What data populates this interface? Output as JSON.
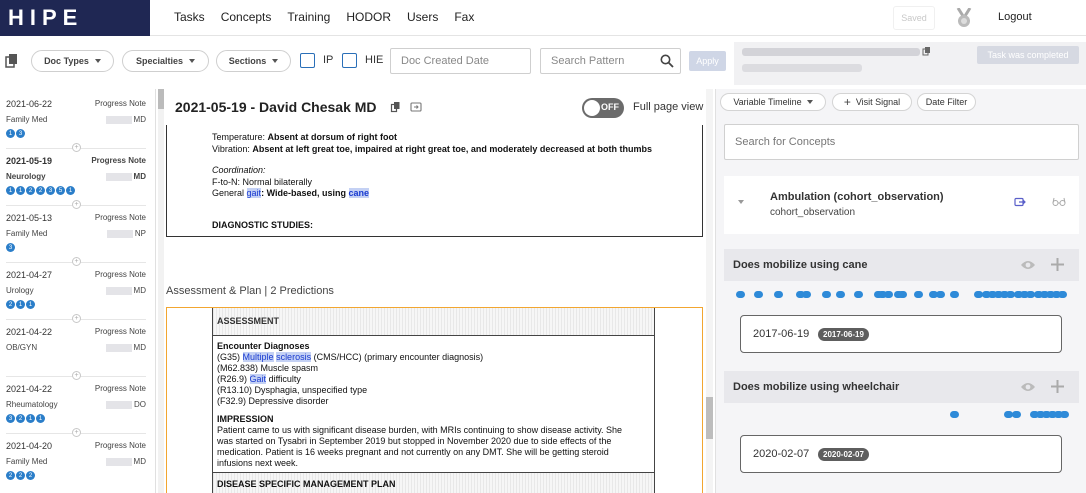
{
  "app": {
    "logo": "HIPE"
  },
  "nav": {
    "links": [
      "Tasks",
      "Concepts",
      "Training",
      "HODOR",
      "Users",
      "Fax"
    ],
    "saved": "Saved",
    "logout": "Logout"
  },
  "filters": {
    "doc_types": "Doc Types",
    "specialties": "Specialties",
    "sections": "Sections",
    "ip": "IP",
    "hie": "HIE",
    "doc_created_placeholder": "Doc Created Date",
    "search_placeholder": "Search Pattern",
    "apply": "Apply",
    "task_status": "Task was completed"
  },
  "doc_list": [
    {
      "date": "2021-06-22",
      "type": "Progress Note",
      "specialty": "Family Med",
      "cred": "MD",
      "badges": [
        "1",
        "3"
      ],
      "selected": false
    },
    {
      "date": "2021-05-19",
      "type": "Progress Note",
      "specialty": "Neurology",
      "cred": "MD",
      "badges": [
        "1",
        "1",
        "2",
        "2",
        "3",
        "5",
        "1"
      ],
      "selected": true
    },
    {
      "date": "2021-05-13",
      "type": "Progress Note",
      "specialty": "Family Med",
      "cred": "NP",
      "badges": [
        "3"
      ],
      "selected": false
    },
    {
      "date": "2021-04-27",
      "type": "Progress Note",
      "specialty": "Urology",
      "cred": "MD",
      "badges": [
        "2",
        "1",
        "1"
      ],
      "selected": false
    },
    {
      "date": "2021-04-22",
      "type": "Progress Note",
      "specialty": "OB/GYN",
      "cred": "MD",
      "badges": [],
      "selected": false
    },
    {
      "date": "2021-04-22",
      "type": "Progress Note",
      "specialty": "Rheumatology",
      "cred": "DO",
      "badges": [
        "3",
        "2",
        "1",
        "1"
      ],
      "selected": false
    },
    {
      "date": "2021-04-20",
      "type": "Progress Note",
      "specialty": "Family Med",
      "cred": "MD",
      "badges": [
        "2",
        "2",
        "2"
      ],
      "selected": false
    }
  ],
  "viewer": {
    "title": "2021-05-19 - David Chesak MD",
    "toggle": "OFF",
    "full_page": "Full page view",
    "exam": {
      "temp_label": "Temperature:",
      "temp_value": "Absent at dorsum of right foot",
      "vib_label": "Vibration:",
      "vib_value": "Absent at left great toe, impaired at right great toe, and moderately decreased at both thumbs",
      "coord": "Coordination:",
      "ftn": "F-to-N:  Normal bilaterally",
      "gait_label": "General",
      "gait_hl": "gait",
      "gait_value": "Wide-based, using",
      "cane_hl": "cane",
      "diag": "DIAGNOSTIC STUDIES:"
    },
    "ap_label": "Assessment & Plan | 2 Predictions",
    "assessment": {
      "head": "ASSESSMENT",
      "enc": "Encounter Diagnoses",
      "dx1_pre": "(G35)",
      "dx1_hl1": "Multiple",
      "dx1_hl2": "sclerosis",
      "dx1_post": "(CMS/HCC)  (primary encounter diagnosis)",
      "dx2": "(M62.838) Muscle spasm",
      "dx3_pre": "(R26.9)",
      "dx3_hl": "Gait",
      "dx3_post": "difficulty",
      "dx4": "(R13.10) Dysphagia, unspecified type",
      "dx5": "(F32.9) Depressive disorder",
      "impression": "IMPRESSION",
      "imp1": "Patient came to us with significant disease burden, with MRIs continuing to show disease activity. She",
      "imp2": "was started on Tysabri in September 2019 but stopped in November 2020 due to side effects of the",
      "imp3": "medication. Patient is 16 weeks pregnant and not currently on any DMT. She will be getting steroid",
      "imp4": "infusions next week.",
      "dsmp": "DISEASE SPECIFIC MANAGEMENT PLAN"
    }
  },
  "right": {
    "variable_timeline": "Variable Timeline",
    "visit_signal": "Visit Signal",
    "date_filter": "Date Filter",
    "concept_search_placeholder": "Search for Concepts",
    "concept_name": "Ambulation (cohort_observation)",
    "concept_sub": "cohort_observation",
    "signals": [
      {
        "title": "Does mobilize using cane",
        "date": "2017-06-19",
        "chip": "2017-06-19"
      },
      {
        "title": "Does mobilize using wheelchair",
        "date": "2020-02-07",
        "chip": "2020-02-07"
      }
    ]
  },
  "colors": {
    "brand": "#1f2753",
    "accent": "#2b7ec9",
    "highlight": "#c4d1f4",
    "prediction_border": "#f2a630"
  }
}
